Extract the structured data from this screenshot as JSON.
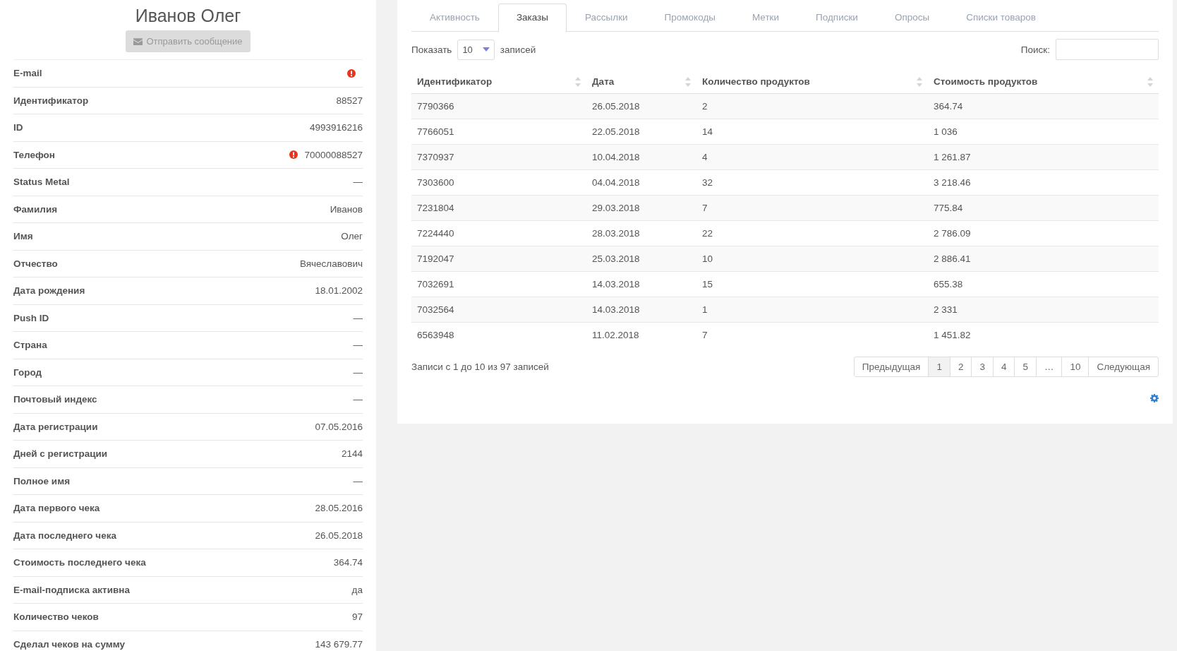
{
  "profile": {
    "name": "Иванов Олег",
    "send_button": {
      "label": "Отправить сообщение",
      "disabled": true
    },
    "fields": [
      {
        "label": "E-mail",
        "alert": true
      },
      {
        "label": "Идентификатор",
        "value": "88527",
        "alert": false
      },
      {
        "label": "ID",
        "value": "4993916216",
        "alert": false
      },
      {
        "label": "Телефон",
        "value": "70000088527",
        "alert": true
      },
      {
        "label": "Status Metal",
        "value": "—",
        "alert": false
      },
      {
        "label": "Фамилия",
        "value": "Иванов",
        "alert": false
      },
      {
        "label": "Имя",
        "value": "Олег",
        "alert": false
      },
      {
        "label": "Отчество",
        "value": "Вячеславович",
        "alert": false
      },
      {
        "label": "Дата рождения",
        "value": "18.01.2002",
        "alert": false
      },
      {
        "label": "Push ID",
        "value": "—",
        "alert": false
      },
      {
        "label": "Страна",
        "value": "—",
        "alert": false
      },
      {
        "label": "Город",
        "value": "—",
        "alert": false
      },
      {
        "label": "Почтовый индекс",
        "value": "—",
        "alert": false
      },
      {
        "label": "Дата регистрации",
        "value": "07.05.2016",
        "alert": false
      },
      {
        "label": "Дней с регистрации",
        "value": "2144",
        "alert": false
      },
      {
        "label": "Полное имя",
        "value": "—",
        "alert": false
      },
      {
        "label": "Дата первого чека",
        "value": "28.05.2016",
        "alert": false
      },
      {
        "label": "Дата последнего чека",
        "value": "26.05.2018",
        "alert": false
      },
      {
        "label": "Стоимость последнего чека",
        "value": "364.74",
        "alert": false
      },
      {
        "label": "E-mail-подписка активна",
        "value": "да",
        "alert": false
      },
      {
        "label": "Количество чеков",
        "value": "97",
        "alert": false
      },
      {
        "label": "Сделал чеков на сумму",
        "value": "143 679.77",
        "alert": false
      }
    ]
  },
  "tabs": [
    {
      "label": "Активность",
      "selected": false
    },
    {
      "label": "Заказы",
      "selected": true
    },
    {
      "label": "Рассылки",
      "selected": false
    },
    {
      "label": "Промокоды",
      "selected": false
    },
    {
      "label": "Метки",
      "selected": false
    },
    {
      "label": "Подписки",
      "selected": false
    },
    {
      "label": "Опросы",
      "selected": false
    },
    {
      "label": "Списки товаров",
      "selected": false
    }
  ],
  "length": {
    "before": "Показать",
    "value": "10",
    "after": "записей"
  },
  "search": {
    "label": "Поиск:"
  },
  "table": {
    "columns": [
      "Идентификатор",
      "Дата",
      "Количество продуктов",
      "Стоимость продуктов"
    ],
    "rows": [
      [
        "7790366",
        "26.05.2018",
        "2",
        "364.74"
      ],
      [
        "7766051",
        "22.05.2018",
        "14",
        "1 036"
      ],
      [
        "7370937",
        "10.04.2018",
        "4",
        "1 261.87"
      ],
      [
        "7303600",
        "04.04.2018",
        "32",
        "3 218.46"
      ],
      [
        "7231804",
        "29.03.2018",
        "7",
        "775.84"
      ],
      [
        "7224440",
        "28.03.2018",
        "22",
        "2 786.09"
      ],
      [
        "7192047",
        "25.03.2018",
        "10",
        "2 886.41"
      ],
      [
        "7032691",
        "14.03.2018",
        "15",
        "655.38"
      ],
      [
        "7032564",
        "14.03.2018",
        "1",
        "2 331"
      ],
      [
        "6563948",
        "11.02.2018",
        "7",
        "1 451.82"
      ]
    ]
  },
  "info": "Записи с 1 до 10 из 97 записей",
  "pagination": [
    {
      "label": "Предыдущая",
      "selected": false
    },
    {
      "label": "1",
      "selected": true
    },
    {
      "label": "2",
      "selected": false
    },
    {
      "label": "3",
      "selected": false
    },
    {
      "label": "4",
      "selected": false
    },
    {
      "label": "5",
      "selected": false
    },
    {
      "label": "…",
      "selected": false
    },
    {
      "label": "10",
      "selected": false
    },
    {
      "label": "Следующая",
      "selected": false
    }
  ]
}
